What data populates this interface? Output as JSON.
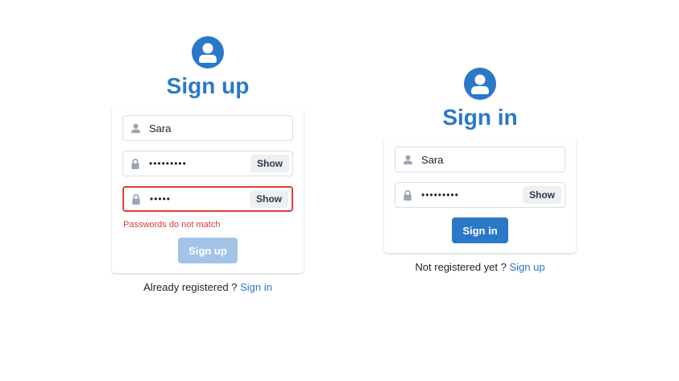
{
  "signup": {
    "title": "Sign up",
    "username_value": "Sara",
    "password_masked": "•••••••••",
    "confirm_masked": "•••••",
    "show_label": "Show",
    "error_text": "Passwords do not match",
    "submit_label": "Sign up",
    "footer_text": "Already registered ? ",
    "footer_link": "Sign in"
  },
  "signin": {
    "title": "Sign in",
    "username_value": "Sara",
    "password_masked": "•••••••••",
    "show_label": "Show",
    "submit_label": "Sign in",
    "footer_text": "Not registered yet ? ",
    "footer_link": "Sign up"
  },
  "icons": {
    "avatar": "user-circle-icon",
    "user": "user-icon",
    "lock": "lock-icon"
  },
  "colors": {
    "brand": "#2b78c6",
    "error": "#dd3c3c",
    "disabled": "#a3c4e8"
  }
}
